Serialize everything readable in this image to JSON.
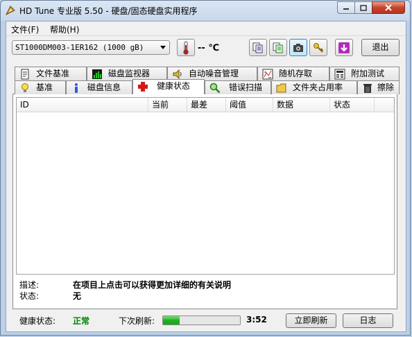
{
  "window": {
    "title": "HD Tune 专业版 5.50 - 硬盘/固态硬盘实用程序"
  },
  "menu": {
    "file": "文件(F)",
    "help": "帮助(H)"
  },
  "toolbar": {
    "drive": "ST1000DM003-1ER162 (1000 gB)",
    "temperature": "-- ℃",
    "exit": "退出",
    "icons": [
      "copy-icon",
      "copy-green-icon",
      "camera-icon",
      "key-icon",
      "download-icon"
    ]
  },
  "tabs_top": [
    {
      "label": "文件基准",
      "icon": "file-benchmark-icon"
    },
    {
      "label": "磁盘监视器",
      "icon": "disk-monitor-icon"
    },
    {
      "label": "自动噪音管理",
      "icon": "speaker-icon"
    },
    {
      "label": "随机存取",
      "icon": "random-access-icon"
    },
    {
      "label": "附加测试",
      "icon": "extra-tests-icon"
    }
  ],
  "tabs_bottom": [
    {
      "label": "基准",
      "icon": "benchmark-bulb-icon"
    },
    {
      "label": "磁盘信息",
      "icon": "info-icon"
    },
    {
      "label": "健康状态",
      "icon": "health-cross-icon"
    },
    {
      "label": "错误扫描",
      "icon": "magnifier-icon"
    },
    {
      "label": "文件夹占用率",
      "icon": "folder-icon"
    },
    {
      "label": "擦除",
      "icon": "trash-icon"
    }
  ],
  "table": {
    "headers": [
      "ID",
      "当前",
      "最差",
      "阈值",
      "数据",
      "状态"
    ]
  },
  "details": {
    "desc_label": "描述:",
    "desc_value": "在项目上点击可以获得更加详细的有关说明",
    "status_label": "状态:",
    "status_value": "无"
  },
  "status": {
    "health_label": "健康状态:",
    "health_value": "正常",
    "health_color": "#008000",
    "next_refresh_label": "下次刷新:",
    "progress_percent": 22,
    "countdown": "3:52",
    "refresh_button": "立即刷新",
    "log_button": "日志"
  }
}
